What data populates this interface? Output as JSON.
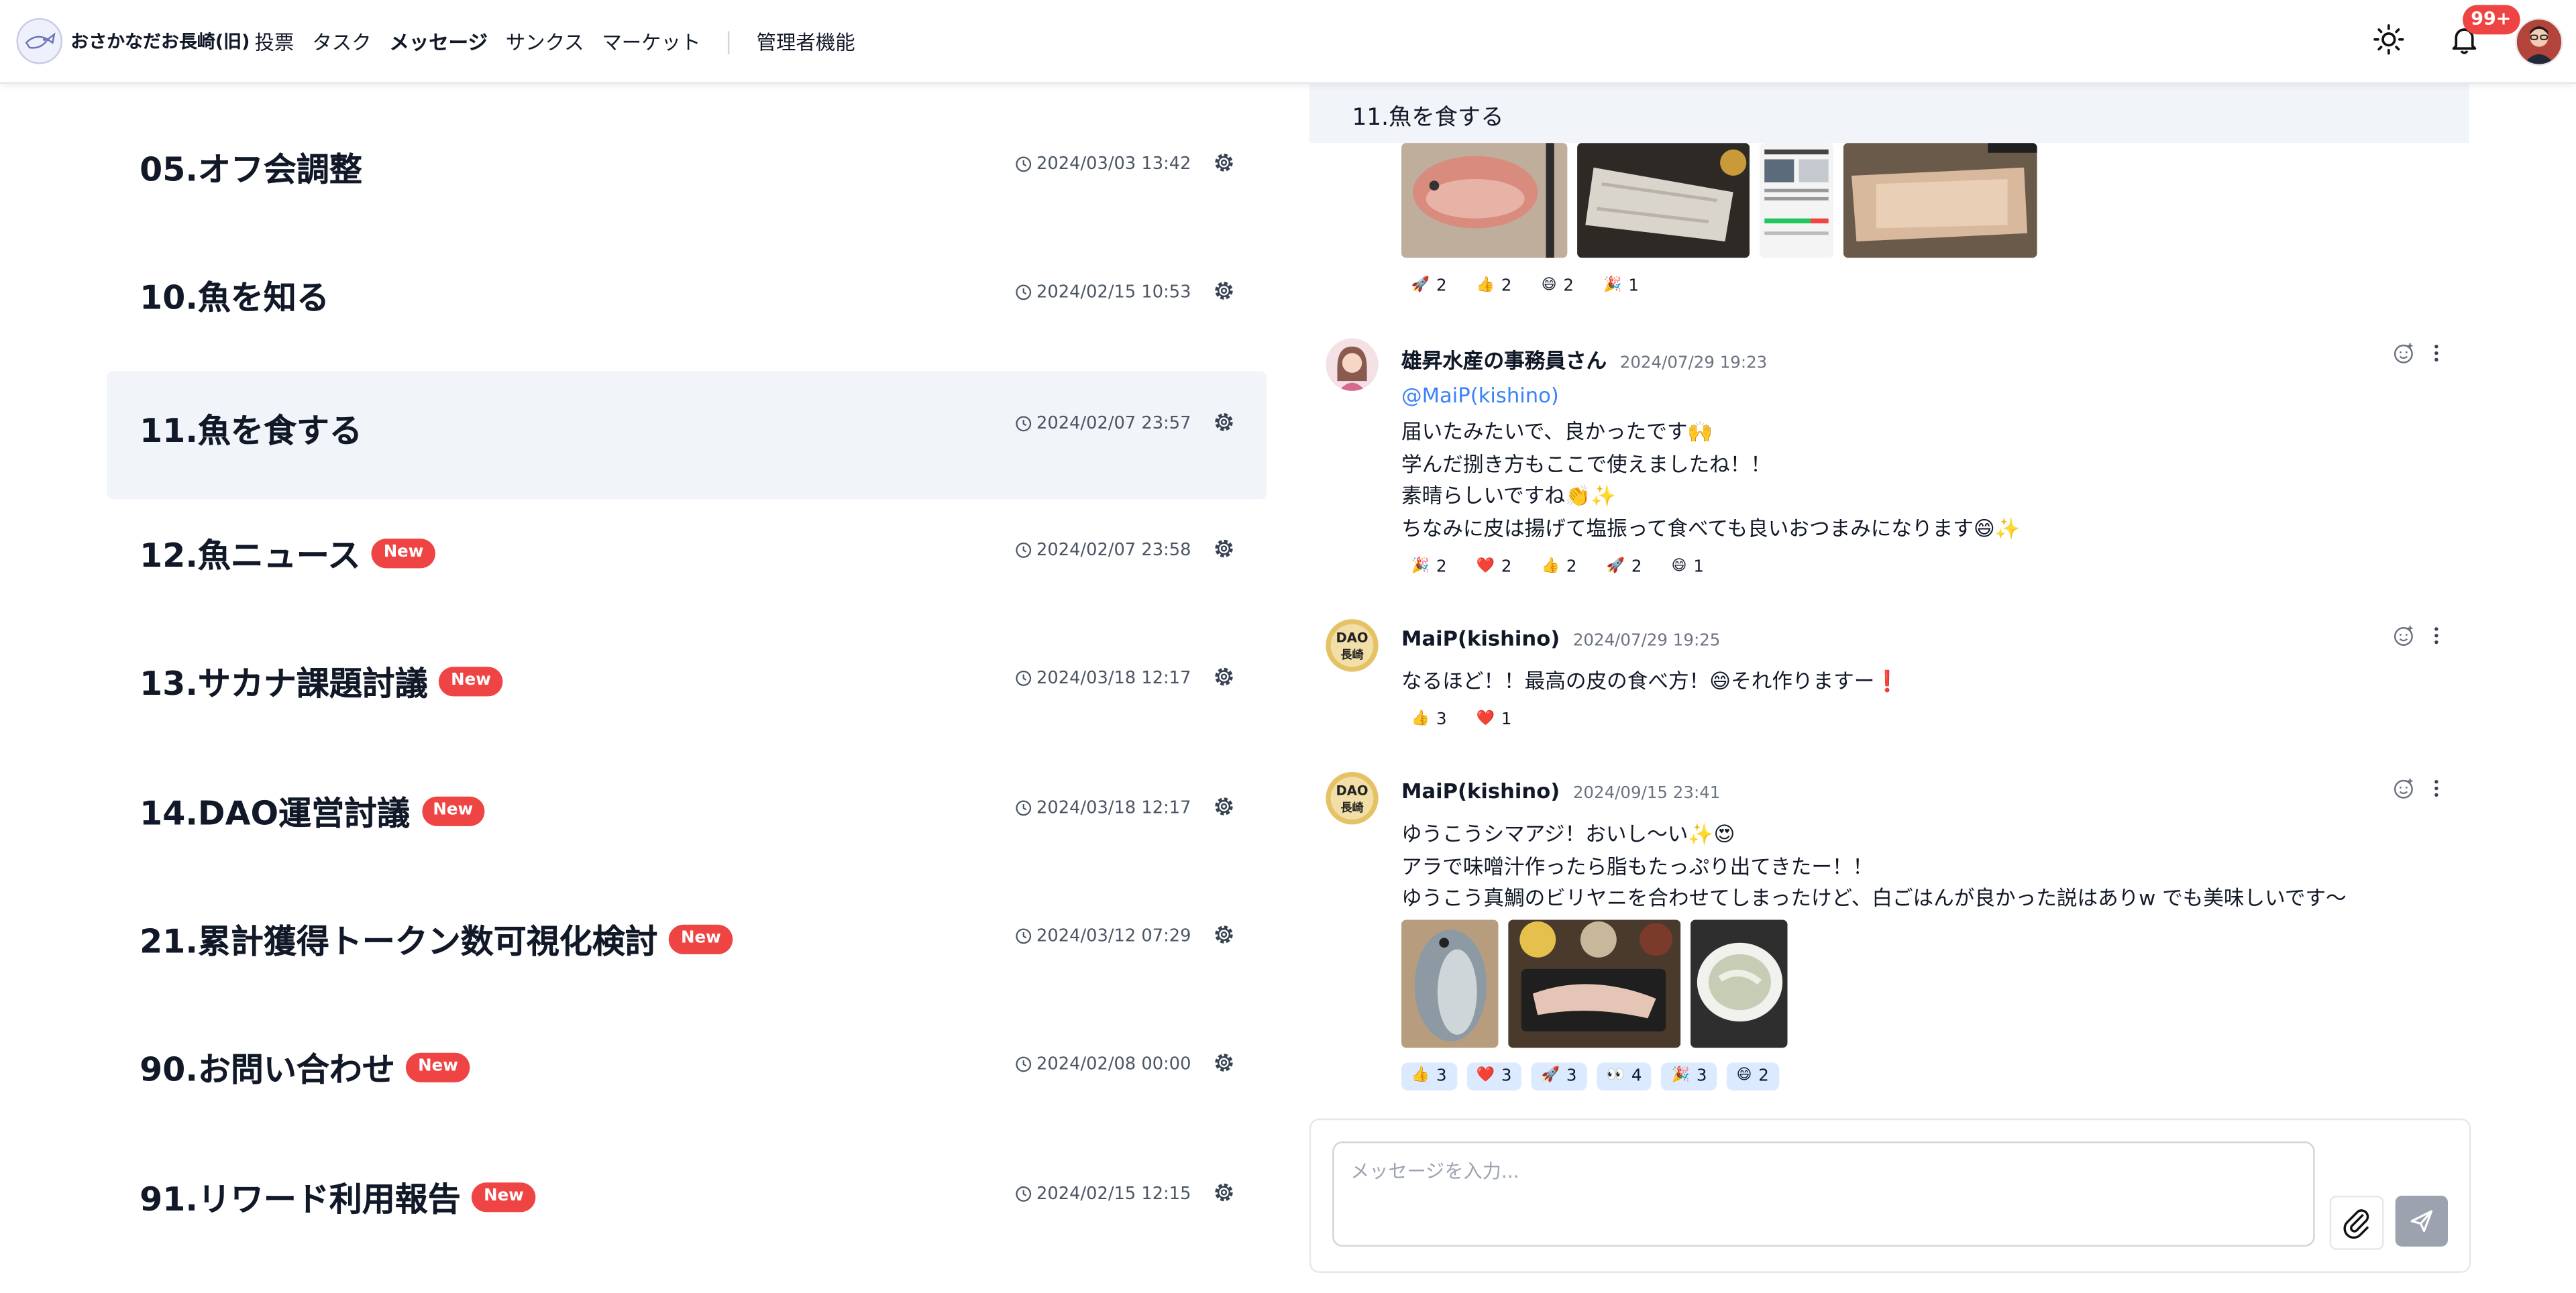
{
  "header": {
    "brand": "おさかなだお長崎(旧)",
    "nav": [
      "投票",
      "タスク",
      "メッセージ",
      "サンクス",
      "マーケット"
    ],
    "active_nav": "メッセージ",
    "admin": "管理者機能",
    "notification_count": "99+",
    "icons": {
      "theme": "sun-icon",
      "notify": "bell-icon"
    }
  },
  "channels": [
    {
      "name": "05.オフ会調整",
      "time": "2024/03/03 13:42",
      "is_new": false,
      "selected": false
    },
    {
      "name": "10.魚を知る",
      "time": "2024/02/15 10:53",
      "is_new": false,
      "selected": false
    },
    {
      "name": "11.魚を食する",
      "time": "2024/02/07 23:57",
      "is_new": false,
      "selected": true
    },
    {
      "name": "12.魚ニュース",
      "time": "2024/02/07 23:58",
      "is_new": true,
      "selected": false
    },
    {
      "name": "13.サカナ課題討議",
      "time": "2024/03/18 12:17",
      "is_new": true,
      "selected": false
    },
    {
      "name": "14.DAO運営討議",
      "time": "2024/03/18 12:17",
      "is_new": true,
      "selected": false
    },
    {
      "name": "21.累計獲得トークン数可視化検討",
      "time": "2024/03/12 07:29",
      "is_new": true,
      "selected": false
    },
    {
      "name": "90.お問い合わせ",
      "time": "2024/02/08 00:00",
      "is_new": true,
      "selected": false
    },
    {
      "name": "91.リワード利用報告",
      "time": "2024/02/15 12:15",
      "is_new": true,
      "selected": false
    }
  ],
  "new_label": "New",
  "chat": {
    "title": "11.魚を食する",
    "top_reactions": [
      {
        "emoji": "🚀",
        "count": "2"
      },
      {
        "emoji": "👍",
        "count": "2"
      },
      {
        "emoji": "😄",
        "count": "2"
      },
      {
        "emoji": "🎉",
        "count": "1"
      }
    ],
    "messages": [
      {
        "author": "雄昇水産の事務員さん",
        "time": "2024/07/29 19:23",
        "mention": "@MaiP(kishino)",
        "lines": [
          "届いたみたいで、良かったです🙌",
          "学んだ捌き方もここで使えましたね！！",
          "素晴らしいですね👏✨",
          "ちなみに皮は揚げて塩振って食べても良いおつまみになります😄✨"
        ],
        "reactions": [
          {
            "emoji": "🎉",
            "count": "2"
          },
          {
            "emoji": "❤️",
            "count": "2"
          },
          {
            "emoji": "👍",
            "count": "2"
          },
          {
            "emoji": "🚀",
            "count": "2"
          },
          {
            "emoji": "😄",
            "count": "1"
          }
        ]
      },
      {
        "author": "MaiP(kishino)",
        "time": "2024/07/29 19:25",
        "lines": [
          "なるほど！！最高の皮の食べ方！😄それ作りますー❗"
        ],
        "reactions": [
          {
            "emoji": "👍",
            "count": "3"
          },
          {
            "emoji": "❤️",
            "count": "1"
          }
        ]
      },
      {
        "author": "MaiP(kishino)",
        "time": "2024/09/15 23:41",
        "lines": [
          "ゆうこうシマアジ！おいし〜い✨😍",
          "アラで味噌汁作ったら脂もたっぷり出てきたー！！",
          "ゆうこう真鯛のビリヤニを合わせてしまったけど、白ごはんが良かった説はありw でも美味しいです〜"
        ],
        "reactions": [
          {
            "emoji": "👍",
            "count": "3"
          },
          {
            "emoji": "❤️",
            "count": "3"
          },
          {
            "emoji": "🚀",
            "count": "3"
          },
          {
            "emoji": "👀",
            "count": "4"
          },
          {
            "emoji": "🎉",
            "count": "3"
          },
          {
            "emoji": "😄",
            "count": "2"
          }
        ]
      }
    ],
    "composer_placeholder": "メッセージを入力..."
  },
  "avatar_text": {
    "dao_line1": "DAO",
    "dao_line2": "長崎"
  }
}
